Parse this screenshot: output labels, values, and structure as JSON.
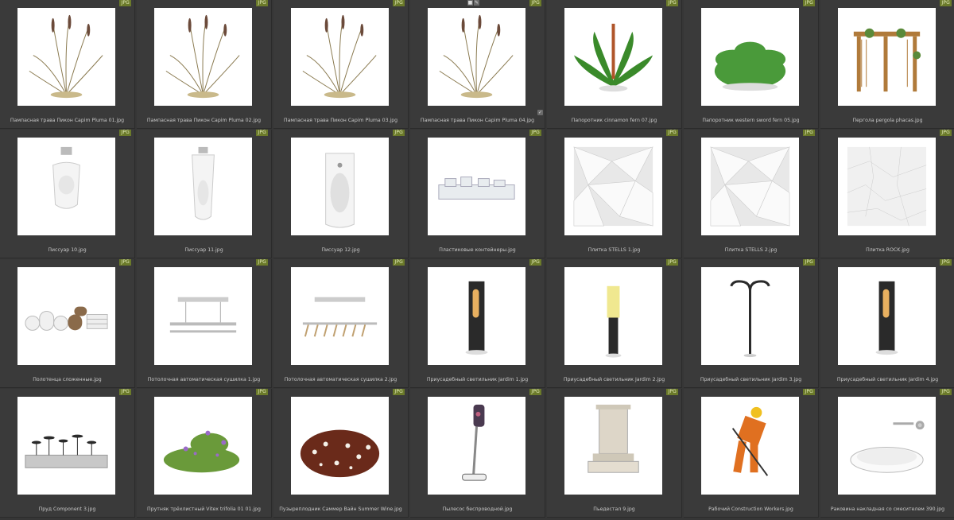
{
  "badge_label": "JPG",
  "items": [
    {
      "name": "Пампасная трава Пикон Capim Pluma 01.jpg",
      "icon": "pampas-grass-icon"
    },
    {
      "name": "Пампасная трава Пикон Capim Pluma 02.jpg",
      "icon": "pampas-grass-icon"
    },
    {
      "name": "Пампасная трава Пикон Capim Pluma 03.jpg",
      "icon": "pampas-grass-icon"
    },
    {
      "name": "Пампасная трава Пикон Capim Pluma 04.jpg",
      "icon": "pampas-grass-icon",
      "checked": true
    },
    {
      "name": "Папоротник cinnamon fern 07.jpg",
      "icon": "fern-icon"
    },
    {
      "name": "Папоротник western sword fern 05.jpg",
      "icon": "fern-bush-icon"
    },
    {
      "name": "Пергола pergola phacas.jpg",
      "icon": "pergola-icon"
    },
    {
      "name": "Писсуар 10.jpg",
      "icon": "urinal-icon"
    },
    {
      "name": "Писсуар 11.jpg",
      "icon": "urinal-tall-icon"
    },
    {
      "name": "Писсуар 12.jpg",
      "icon": "urinal-oval-icon"
    },
    {
      "name": "Пластиковые контейнеры.jpg",
      "icon": "containers-icon"
    },
    {
      "name": "Плитка STELLS 1.jpg",
      "icon": "tile-facets-icon"
    },
    {
      "name": "Плитка STELLS 2.jpg",
      "icon": "tile-facets-icon"
    },
    {
      "name": "Плитка ROCK.jpg",
      "icon": "tile-rock-icon"
    },
    {
      "name": "Полотенца сложенные.jpg",
      "icon": "towels-icon"
    },
    {
      "name": "Потолочная автоматическая сушилка 1.jpg",
      "icon": "dryer-rack-icon"
    },
    {
      "name": "Потолочная автоматическая сушилка 2.jpg",
      "icon": "dryer-rack-hangers-icon"
    },
    {
      "name": "Приусадебный светильник Jardim 1.jpg",
      "icon": "bollard-lamp-icon"
    },
    {
      "name": "Приусадебный светильник Jardim 2.jpg",
      "icon": "post-lamp-icon"
    },
    {
      "name": "Приусадебный светильник Jardim 3.jpg",
      "icon": "double-street-lamp-icon"
    },
    {
      "name": "Приусадебный светильник Jardim 4.jpg",
      "icon": "bollard-lamp-icon"
    },
    {
      "name": "Пруд Component 3.jpg",
      "icon": "pond-planter-icon"
    },
    {
      "name": "Прутняк трёхлистный Vitex trifolia 01 01.jpg",
      "icon": "flower-shrub-icon"
    },
    {
      "name": "Пузыреплодник Саммер Вайн Summer Wine.jpg",
      "icon": "red-shrub-icon"
    },
    {
      "name": "Пылесос беспроводной.jpg",
      "icon": "vacuum-icon"
    },
    {
      "name": "Пьедестал 9.jpg",
      "icon": "pedestal-icon"
    },
    {
      "name": "Рабочий Construction Workers.jpg",
      "icon": "worker-icon"
    },
    {
      "name": "Раковина накладная со смесителем 390.jpg",
      "icon": "sink-icon"
    }
  ]
}
